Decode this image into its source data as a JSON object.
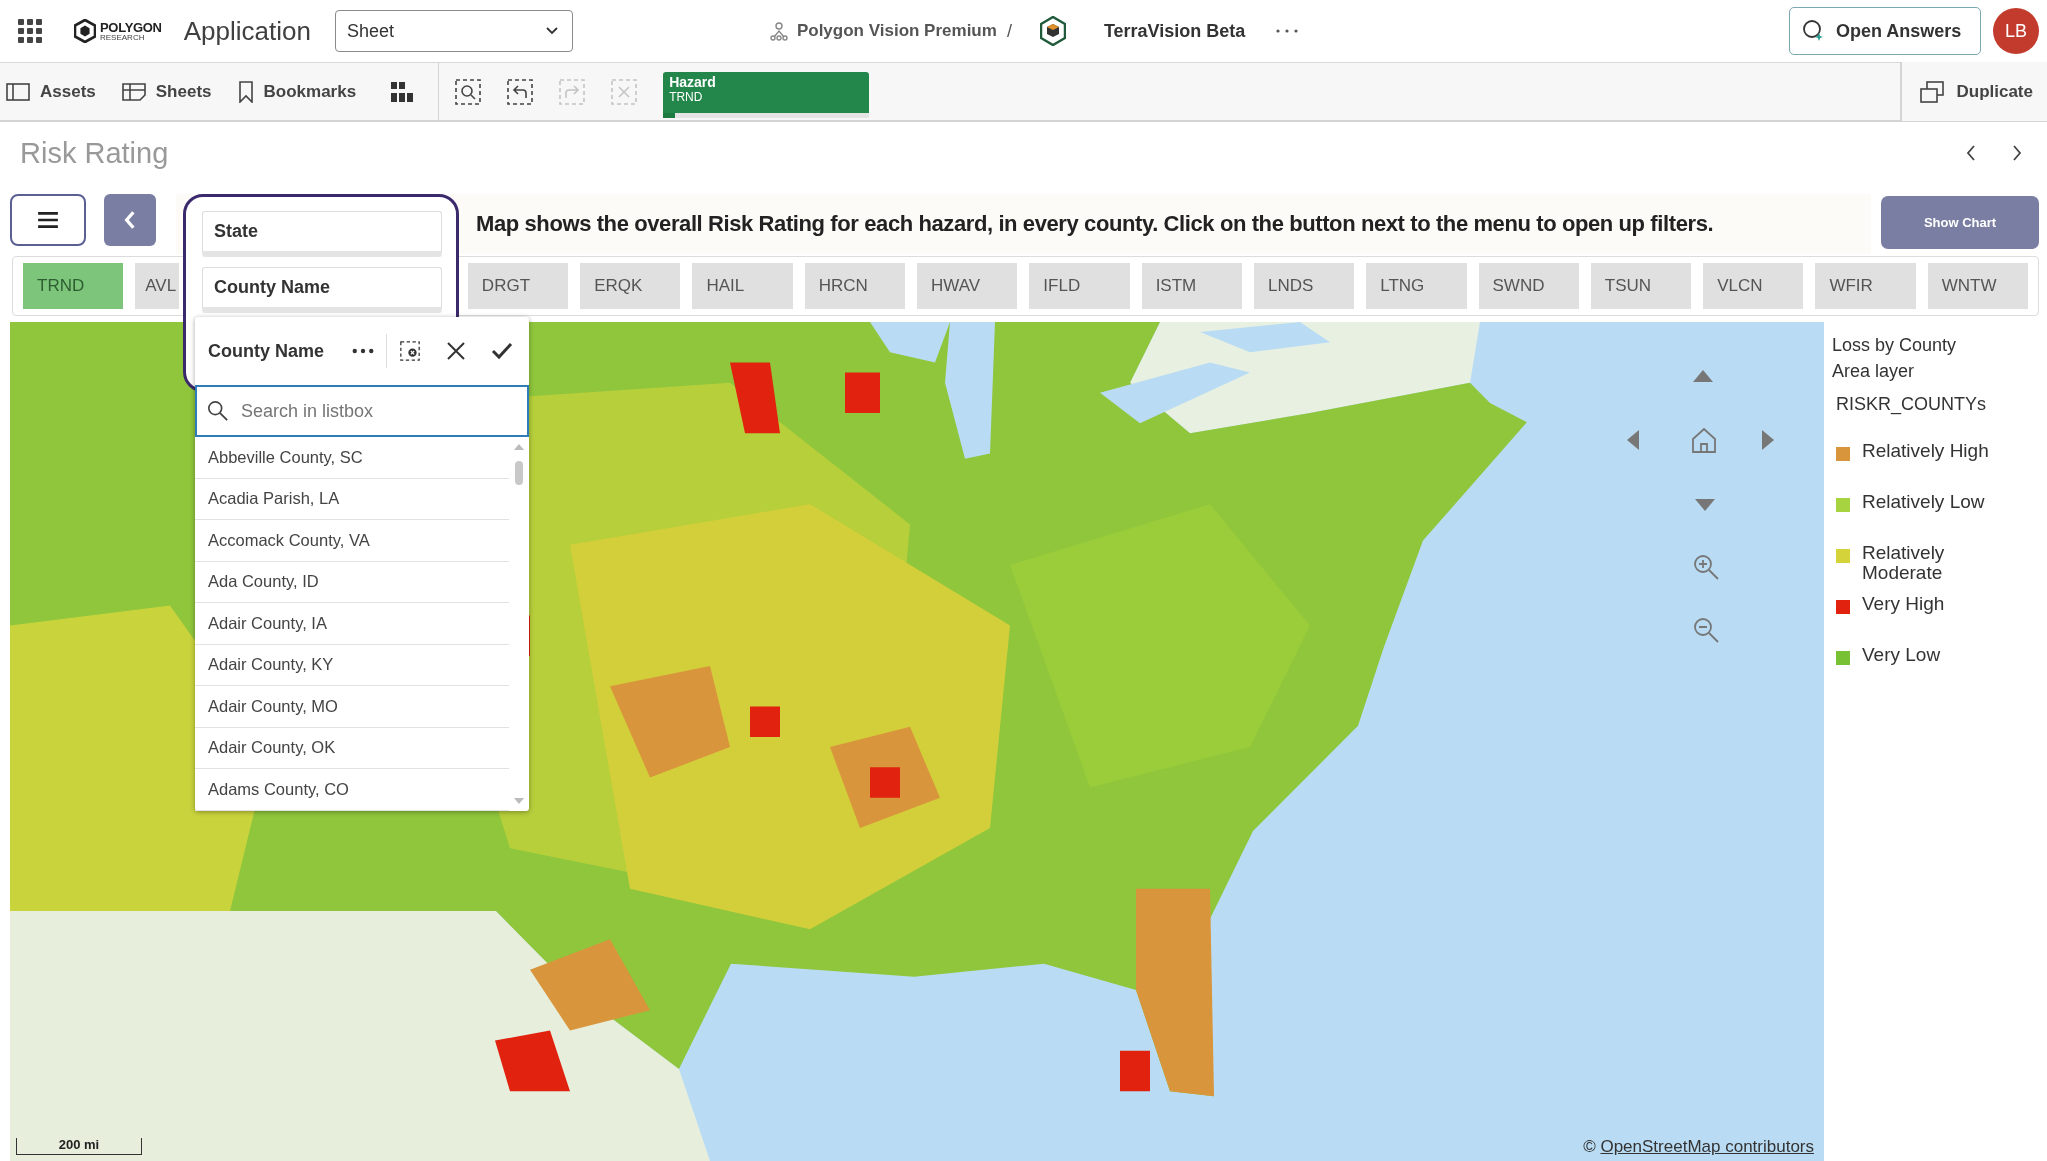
{
  "topbar": {
    "logo_text": "POLYGON",
    "logo_subtext": "RESEARCH",
    "app_name": "Application",
    "sheet_select": "Sheet",
    "space": "Polygon Vision Premium",
    "separator": "/",
    "app_title": "TerraVision Beta",
    "answers_button": "Open Answers",
    "avatar": "LB"
  },
  "toolbar": {
    "items": [
      {
        "kind": "assets",
        "label": "Assets"
      },
      {
        "kind": "sheets",
        "label": "Sheets"
      },
      {
        "kind": "bookmarks",
        "label": "Bookmarks"
      }
    ],
    "selection_tools": [
      {
        "kind": "search",
        "disabled": false
      },
      {
        "kind": "back",
        "disabled": false
      },
      {
        "kind": "forward",
        "disabled": true
      },
      {
        "kind": "clear",
        "disabled": true
      }
    ],
    "selection_chip": {
      "field": "Hazard",
      "value": "TRND",
      "level": 0.06
    },
    "duplicate_button": "Duplicate"
  },
  "sheet": {
    "title": "Risk Rating",
    "description": "Map shows the overall Risk Rating for each hazard, in every county. Click on the button next to the menu to open up filters.",
    "show_chart_button": "Show Chart"
  },
  "filters": [
    {
      "label": "State"
    },
    {
      "label": "County Name"
    }
  ],
  "listbox": {
    "title": "County Name",
    "search_placeholder": "Search in listbox",
    "items": [
      "Abbeville County, SC",
      "Acadia Parish, LA",
      "Accomack County, VA",
      "Ada County, ID",
      "Adair County, IA",
      "Adair County, KY",
      "Adair County, MO",
      "Adair County, OK",
      "Adams County, CO"
    ]
  },
  "hazard_tabs": [
    {
      "label": "TRND",
      "selected": true
    },
    {
      "label": "AVL",
      "selected": false
    },
    {
      "label": "DRGT",
      "selected": false
    },
    {
      "label": "ERQK",
      "selected": false
    },
    {
      "label": "HAIL",
      "selected": false
    },
    {
      "label": "HRCN",
      "selected": false
    },
    {
      "label": "HWAV",
      "selected": false
    },
    {
      "label": "IFLD",
      "selected": false
    },
    {
      "label": "ISTM",
      "selected": false
    },
    {
      "label": "LNDS",
      "selected": false
    },
    {
      "label": "LTNG",
      "selected": false
    },
    {
      "label": "SWND",
      "selected": false
    },
    {
      "label": "TSUN",
      "selected": false
    },
    {
      "label": "VLCN",
      "selected": false
    },
    {
      "label": "WFIR",
      "selected": false
    },
    {
      "label": "WNTW",
      "selected": false
    }
  ],
  "map": {
    "kind": "picture",
    "scale": "200 mi",
    "attribution_prefix": "©",
    "attribution_link": "OpenStreetMap contributors"
  },
  "legend": {
    "title": "Loss by County",
    "subtitle": "Area layer",
    "field": "RISKR_COUNTYs",
    "items": [
      {
        "label": "Relatively High",
        "color": "#d9953b"
      },
      {
        "label": "Relatively Low",
        "color": "#a6d33f"
      },
      {
        "label": "Relatively Moderate",
        "color": "#d5d33a"
      },
      {
        "label": "Very High",
        "color": "#e0220e"
      },
      {
        "label": "Very Low",
        "color": "#79c134"
      }
    ]
  }
}
